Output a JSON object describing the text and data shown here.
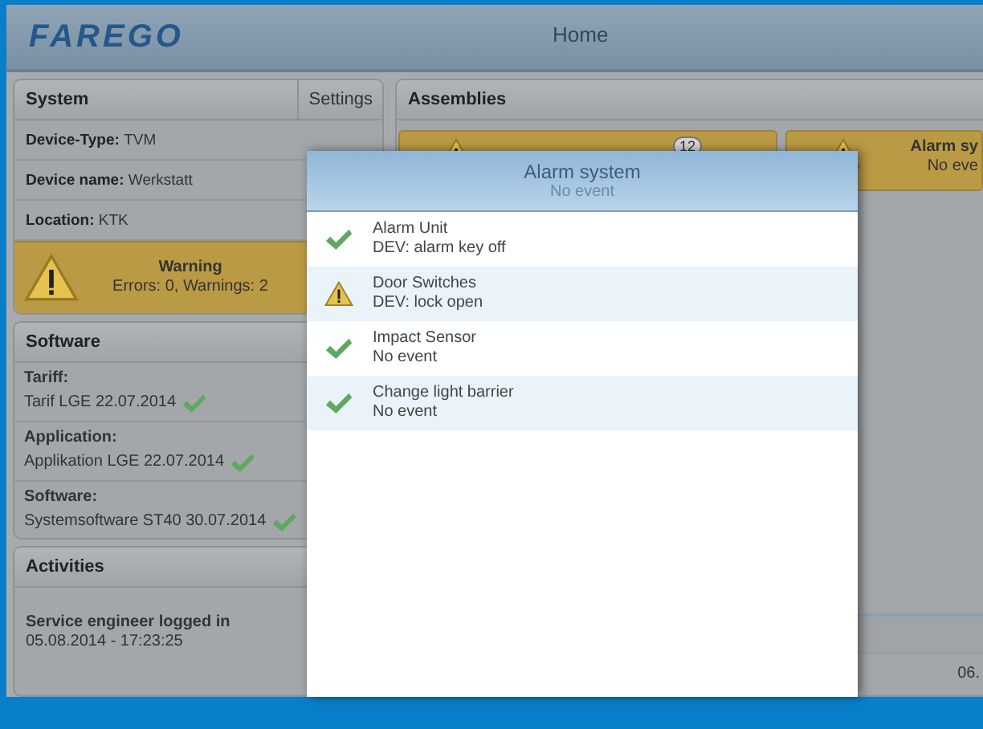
{
  "header": {
    "logo": "FAREGO",
    "title": "Home"
  },
  "system": {
    "title": "System",
    "settings": "Settings",
    "fields": [
      {
        "label": "Device-Type:",
        "value": "TVM"
      },
      {
        "label": "Device name:",
        "value": "Werkstatt"
      },
      {
        "label": "Location:",
        "value": "KTK"
      }
    ]
  },
  "warning": {
    "title": "Warning",
    "detail": "Errors: 0, Warnings: 2"
  },
  "software": {
    "title": "Software",
    "items": [
      {
        "label": "Tariff:",
        "value": "Tarif LGE 22.07.2014",
        "ok": true
      },
      {
        "label": "Application:",
        "value": "Applikation LGE 22.07.2014",
        "ok": true
      },
      {
        "label": "Software:",
        "value": "Systemsoftware ST40 30.07.2014",
        "ok": true
      }
    ]
  },
  "activities": {
    "title": "Activities",
    "entries": [
      {
        "text": "Service engineer logged in",
        "time": "05.08.2014 - 17:23:25"
      }
    ]
  },
  "assemblies": {
    "title": "Assemblies",
    "tiles": [
      {
        "kind": "badge",
        "badge": "12"
      },
      {
        "kind": "status",
        "title": "Alarm sy",
        "subtitle": "No eve"
      }
    ],
    "footer_time": "06."
  },
  "dialog": {
    "title": "Alarm system",
    "subtitle": "No event",
    "items": [
      {
        "name": "Alarm Unit",
        "detail": "DEV: alarm key off",
        "kind": "ok"
      },
      {
        "name": "Door Switches",
        "detail": "DEV: lock open",
        "kind": "warning"
      },
      {
        "name": "Impact Sensor",
        "detail": "No event",
        "kind": "ok"
      },
      {
        "name": "Change light barrier",
        "detail": "No event",
        "kind": "ok"
      }
    ]
  }
}
